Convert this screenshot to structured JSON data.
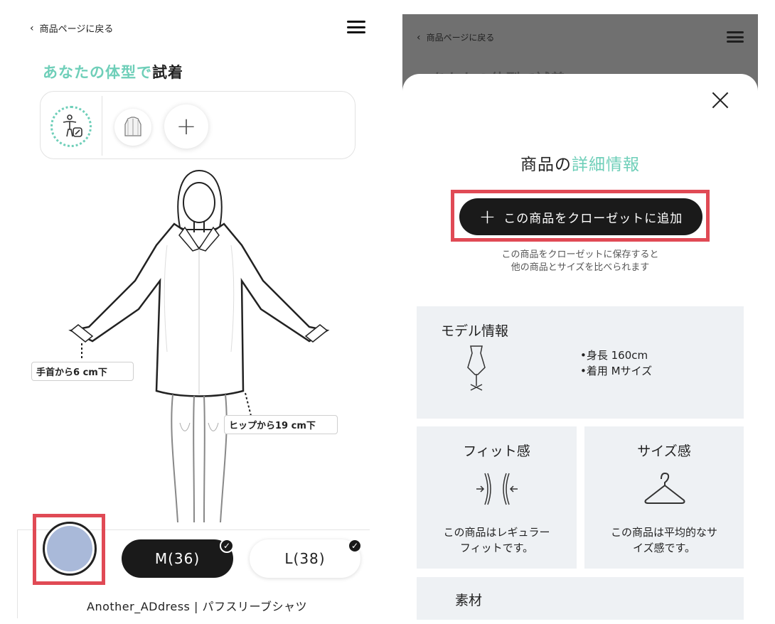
{
  "left": {
    "back_label": "商品ページに戻る",
    "title_accent": "あなたの体型で",
    "title_rest": "試着",
    "body_icon": "body-edit-icon",
    "shirt_icon": "shirt-icon",
    "add_icon": "plus-icon",
    "wrist_tag": "手首から6 cm下",
    "hip_tag": "ヒップから19 cm下",
    "sizes": [
      {
        "label": "M(36)",
        "selected": true
      },
      {
        "label": "L(38)",
        "selected": false
      }
    ],
    "product_name": "Another_ADdress | パフスリーブシャツ"
  },
  "right": {
    "back_label": "商品ページに戻る",
    "faded_title": "あなたの体型で試着",
    "sheet_title_plain": "商品の",
    "sheet_title_accent": "詳細情報",
    "add_button": "この商品をクローゼットに追加",
    "hint_line1": "この商品をクローゼットに保存すると",
    "hint_line2": "他の商品とサイズを比べられます",
    "model": {
      "title": "モデル情報",
      "height": "•身長 160cm",
      "wearing": "•着用 Mサイズ"
    },
    "fit": {
      "title": "フィット感",
      "desc_line1": "この商品はレギュラー",
      "desc_line2": "フィットです。"
    },
    "size": {
      "title": "サイズ感",
      "desc_line1": "この商品は平均的なサ",
      "desc_line2": "イズ感です。"
    },
    "material": {
      "title": "素材"
    }
  },
  "colors": {
    "accent": "#6fcfb9",
    "highlight": "#e04a55",
    "dark": "#1a1a1a"
  }
}
